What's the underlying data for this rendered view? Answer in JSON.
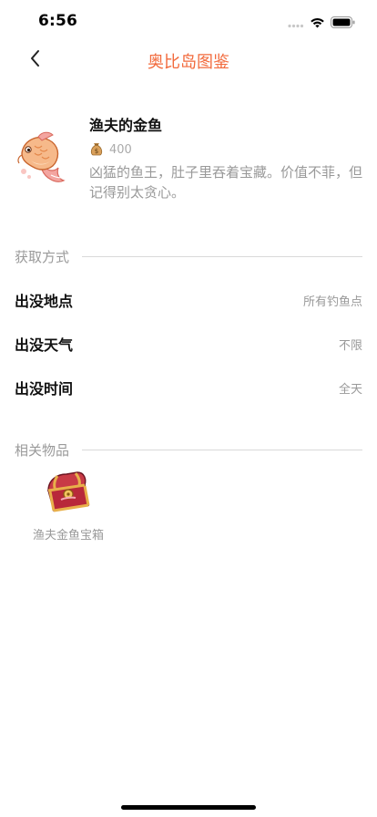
{
  "status_bar": {
    "time": "6:56"
  },
  "nav": {
    "title": "奥比岛图鉴"
  },
  "item": {
    "name": "渔夫的金鱼",
    "price": "400",
    "description": "凶猛的鱼王，肚子里吞着宝藏。价值不菲，但记得别太贪心。"
  },
  "acquire": {
    "title": "获取方式",
    "rows": [
      {
        "label": "出没地点",
        "value": "所有钓鱼点"
      },
      {
        "label": "出没天气",
        "value": "不限"
      },
      {
        "label": "出没时间",
        "value": "全天"
      }
    ]
  },
  "related": {
    "title": "相关物品",
    "items": [
      {
        "label": "渔夫金鱼宝箱"
      }
    ]
  },
  "icons": {
    "back": "chevron-left-icon",
    "coin_bag": "money-bag-icon",
    "goldfish": "goldfish-icon",
    "chest": "treasure-chest-icon"
  },
  "colors": {
    "accent": "#f26a3c"
  }
}
